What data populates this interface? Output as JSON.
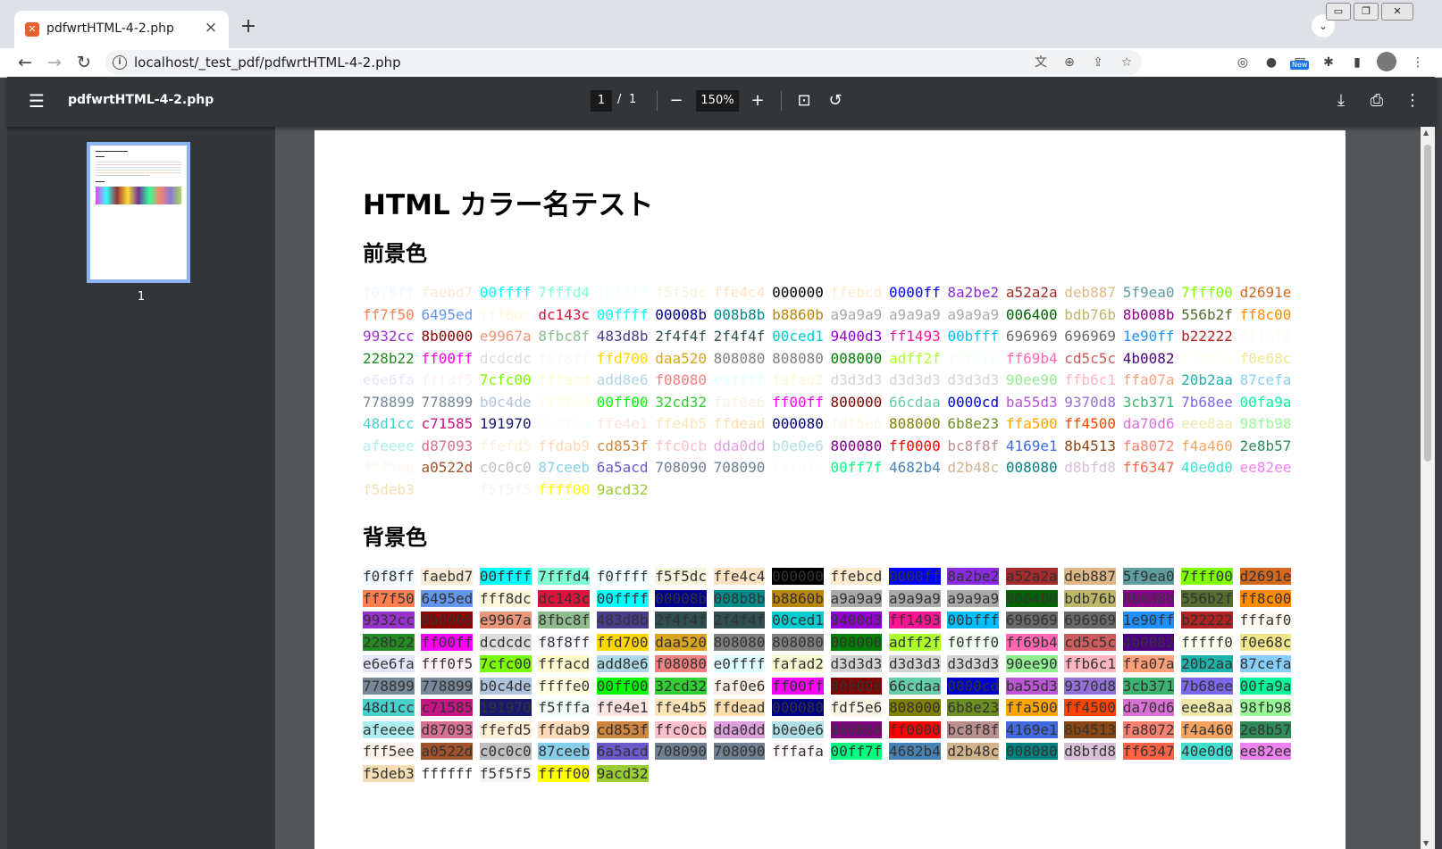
{
  "browser": {
    "tab_title": "pdfwrtHTML-4-2.php",
    "tab_favicon": "xampp-icon",
    "tab_close": "×",
    "new_tab": "+",
    "tab_search": "⌄",
    "window_buttons": [
      "▭",
      "❐",
      "✕"
    ],
    "url": "localhost/_test_pdf/pdfwrtHTML-4-2.php",
    "new_badge": "New"
  },
  "pdf_viewer": {
    "file_title": "pdfwrtHTML-4-2.php",
    "current_page": "1",
    "page_separator": "/",
    "total_pages": "1",
    "zoom": "150%",
    "thumbnail_page": "1"
  },
  "document": {
    "title": "HTML カラー名テスト",
    "foreground_heading": "前景色",
    "background_heading": "背景色"
  },
  "colors": [
    [
      "f0f8ff",
      "#f0f8ff"
    ],
    [
      "faebd7",
      "#faebd7"
    ],
    [
      "00ffff",
      "#00ffff"
    ],
    [
      "7fffd4",
      "#7fffd4"
    ],
    [
      "f0ffff",
      "#f0ffff"
    ],
    [
      "f5f5dc",
      "#f5f5dc"
    ],
    [
      "ffe4c4",
      "#ffe4c4"
    ],
    [
      "000000",
      "#000000"
    ],
    [
      "ffebcd",
      "#ffebcd"
    ],
    [
      "0000ff",
      "#0000ff"
    ],
    [
      "8a2be2",
      "#8a2be2"
    ],
    [
      "a52a2a",
      "#a52a2a"
    ],
    [
      "deb887",
      "#deb887"
    ],
    [
      "5f9ea0",
      "#5f9ea0"
    ],
    [
      "7fff00",
      "#7fff00"
    ],
    [
      "d2691e",
      "#d2691e"
    ],
    [
      "ff7f50",
      "#ff7f50"
    ],
    [
      "6495ed",
      "#6495ed"
    ],
    [
      "fff8dc",
      "#fff8dc"
    ],
    [
      "dc143c",
      "#dc143c"
    ],
    [
      "00ffff",
      "#00ffff"
    ],
    [
      "00008b",
      "#00008b"
    ],
    [
      "008b8b",
      "#008b8b"
    ],
    [
      "b8860b",
      "#b8860b"
    ],
    [
      "a9a9a9",
      "#a9a9a9"
    ],
    [
      "a9a9a9",
      "#a9a9a9"
    ],
    [
      "a9a9a9",
      "#a9a9a9"
    ],
    [
      "006400",
      "#006400"
    ],
    [
      "bdb76b",
      "#bdb76b"
    ],
    [
      "8b008b",
      "#8b008b"
    ],
    [
      "556b2f",
      "#556b2f"
    ],
    [
      "ff8c00",
      "#ff8c00"
    ],
    [
      "9932cc",
      "#9932cc"
    ],
    [
      "8b0000",
      "#8b0000"
    ],
    [
      "e9967a",
      "#e9967a"
    ],
    [
      "8fbc8f",
      "#8fbc8f"
    ],
    [
      "483d8b",
      "#483d8b"
    ],
    [
      "2f4f4f",
      "#2f4f4f"
    ],
    [
      "2f4f4f",
      "#2f4f4f"
    ],
    [
      "00ced1",
      "#00ced1"
    ],
    [
      "9400d3",
      "#9400d3"
    ],
    [
      "ff1493",
      "#ff1493"
    ],
    [
      "00bfff",
      "#00bfff"
    ],
    [
      "696969",
      "#696969"
    ],
    [
      "696969",
      "#696969"
    ],
    [
      "1e90ff",
      "#1e90ff"
    ],
    [
      "b22222",
      "#b22222"
    ],
    [
      "fffaf0",
      "#fffaf0"
    ],
    [
      "228b22",
      "#228b22"
    ],
    [
      "ff00ff",
      "#ff00ff"
    ],
    [
      "dcdcdc",
      "#dcdcdc"
    ],
    [
      "f8f8ff",
      "#f8f8ff"
    ],
    [
      "ffd700",
      "#ffd700"
    ],
    [
      "daa520",
      "#daa520"
    ],
    [
      "808080",
      "#808080"
    ],
    [
      "808080",
      "#808080"
    ],
    [
      "008000",
      "#008000"
    ],
    [
      "adff2f",
      "#adff2f"
    ],
    [
      "f0fff0",
      "#f0fff0"
    ],
    [
      "ff69b4",
      "#ff69b4"
    ],
    [
      "cd5c5c",
      "#cd5c5c"
    ],
    [
      "4b0082",
      "#4b0082"
    ],
    [
      "fffff0",
      "#fffff0"
    ],
    [
      "f0e68c",
      "#f0e68c"
    ],
    [
      "e6e6fa",
      "#e6e6fa"
    ],
    [
      "fff0f5",
      "#fff0f5"
    ],
    [
      "7cfc00",
      "#7cfc00"
    ],
    [
      "fffacd",
      "#fffacd"
    ],
    [
      "add8e6",
      "#add8e6"
    ],
    [
      "f08080",
      "#f08080"
    ],
    [
      "e0ffff",
      "#e0ffff"
    ],
    [
      "fafad2",
      "#fafad2"
    ],
    [
      "d3d3d3",
      "#d3d3d3"
    ],
    [
      "d3d3d3",
      "#d3d3d3"
    ],
    [
      "d3d3d3",
      "#d3d3d3"
    ],
    [
      "90ee90",
      "#90ee90"
    ],
    [
      "ffb6c1",
      "#ffb6c1"
    ],
    [
      "ffa07a",
      "#ffa07a"
    ],
    [
      "20b2aa",
      "#20b2aa"
    ],
    [
      "87cefa",
      "#87cefa"
    ],
    [
      "778899",
      "#778899"
    ],
    [
      "778899",
      "#778899"
    ],
    [
      "b0c4de",
      "#b0c4de"
    ],
    [
      "ffffe0",
      "#ffffe0"
    ],
    [
      "00ff00",
      "#00ff00"
    ],
    [
      "32cd32",
      "#32cd32"
    ],
    [
      "faf0e6",
      "#faf0e6"
    ],
    [
      "ff00ff",
      "#ff00ff"
    ],
    [
      "800000",
      "#800000"
    ],
    [
      "66cdaa",
      "#66cdaa"
    ],
    [
      "0000cd",
      "#0000cd"
    ],
    [
      "ba55d3",
      "#ba55d3"
    ],
    [
      "9370d8",
      "#9370d8"
    ],
    [
      "3cb371",
      "#3cb371"
    ],
    [
      "7b68ee",
      "#7b68ee"
    ],
    [
      "00fa9a",
      "#00fa9a"
    ],
    [
      "48d1cc",
      "#48d1cc"
    ],
    [
      "c71585",
      "#c71585"
    ],
    [
      "191970",
      "#191970"
    ],
    [
      "f5fffa",
      "#f5fffa"
    ],
    [
      "ffe4e1",
      "#ffe4e1"
    ],
    [
      "ffe4b5",
      "#ffe4b5"
    ],
    [
      "ffdead",
      "#ffdead"
    ],
    [
      "000080",
      "#000080"
    ],
    [
      "fdf5e6",
      "#fdf5e6"
    ],
    [
      "808000",
      "#808000"
    ],
    [
      "6b8e23",
      "#6b8e23"
    ],
    [
      "ffa500",
      "#ffa500"
    ],
    [
      "ff4500",
      "#ff4500"
    ],
    [
      "da70d6",
      "#da70d6"
    ],
    [
      "eee8aa",
      "#eee8aa"
    ],
    [
      "98fb98",
      "#98fb98"
    ],
    [
      "afeeee",
      "#afeeee"
    ],
    [
      "d87093",
      "#d87093"
    ],
    [
      "ffefd5",
      "#ffefd5"
    ],
    [
      "ffdab9",
      "#ffdab9"
    ],
    [
      "cd853f",
      "#cd853f"
    ],
    [
      "ffc0cb",
      "#ffc0cb"
    ],
    [
      "dda0dd",
      "#dda0dd"
    ],
    [
      "b0e0e6",
      "#b0e0e6"
    ],
    [
      "800080",
      "#800080"
    ],
    [
      "ff0000",
      "#ff0000"
    ],
    [
      "bc8f8f",
      "#bc8f8f"
    ],
    [
      "4169e1",
      "#4169e1"
    ],
    [
      "8b4513",
      "#8b4513"
    ],
    [
      "fa8072",
      "#fa8072"
    ],
    [
      "f4a460",
      "#f4a460"
    ],
    [
      "2e8b57",
      "#2e8b57"
    ],
    [
      "fff5ee",
      "#fff5ee"
    ],
    [
      "a0522d",
      "#a0522d"
    ],
    [
      "c0c0c0",
      "#c0c0c0"
    ],
    [
      "87ceeb",
      "#87ceeb"
    ],
    [
      "6a5acd",
      "#6a5acd"
    ],
    [
      "708090",
      "#708090"
    ],
    [
      "708090",
      "#708090"
    ],
    [
      "fffafa",
      "#fffafa"
    ],
    [
      "00ff7f",
      "#00ff7f"
    ],
    [
      "4682b4",
      "#4682b4"
    ],
    [
      "d2b48c",
      "#d2b48c"
    ],
    [
      "008080",
      "#008080"
    ],
    [
      "d8bfd8",
      "#d8bfd8"
    ],
    [
      "ff6347",
      "#ff6347"
    ],
    [
      "40e0d0",
      "#40e0d0"
    ],
    [
      "ee82ee",
      "#ee82ee"
    ],
    [
      "f5deb3",
      "#f5deb3"
    ],
    [
      "ffffff",
      "#ffffff"
    ],
    [
      "f5f5f5",
      "#f5f5f5"
    ],
    [
      "ffff00",
      "#ffff00"
    ],
    [
      "9acd32",
      "#9acd32"
    ]
  ]
}
